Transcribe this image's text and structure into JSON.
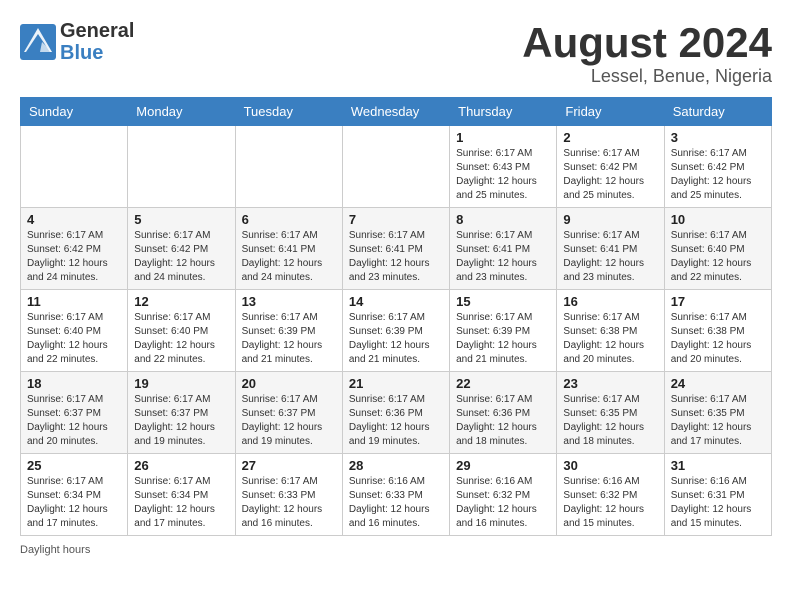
{
  "header": {
    "logo_general": "General",
    "logo_blue": "Blue",
    "main_title": "August 2024",
    "subtitle": "Lessel, Benue, Nigeria"
  },
  "footer": {
    "note": "Daylight hours"
  },
  "days_of_week": [
    "Sunday",
    "Monday",
    "Tuesday",
    "Wednesday",
    "Thursday",
    "Friday",
    "Saturday"
  ],
  "weeks": [
    [
      {
        "day": "",
        "sunrise": "",
        "sunset": "",
        "daylight": ""
      },
      {
        "day": "",
        "sunrise": "",
        "sunset": "",
        "daylight": ""
      },
      {
        "day": "",
        "sunrise": "",
        "sunset": "",
        "daylight": ""
      },
      {
        "day": "",
        "sunrise": "",
        "sunset": "",
        "daylight": ""
      },
      {
        "day": "1",
        "sunrise": "Sunrise: 6:17 AM",
        "sunset": "Sunset: 6:43 PM",
        "daylight": "Daylight: 12 hours and 25 minutes."
      },
      {
        "day": "2",
        "sunrise": "Sunrise: 6:17 AM",
        "sunset": "Sunset: 6:42 PM",
        "daylight": "Daylight: 12 hours and 25 minutes."
      },
      {
        "day": "3",
        "sunrise": "Sunrise: 6:17 AM",
        "sunset": "Sunset: 6:42 PM",
        "daylight": "Daylight: 12 hours and 25 minutes."
      }
    ],
    [
      {
        "day": "4",
        "sunrise": "Sunrise: 6:17 AM",
        "sunset": "Sunset: 6:42 PM",
        "daylight": "Daylight: 12 hours and 24 minutes."
      },
      {
        "day": "5",
        "sunrise": "Sunrise: 6:17 AM",
        "sunset": "Sunset: 6:42 PM",
        "daylight": "Daylight: 12 hours and 24 minutes."
      },
      {
        "day": "6",
        "sunrise": "Sunrise: 6:17 AM",
        "sunset": "Sunset: 6:41 PM",
        "daylight": "Daylight: 12 hours and 24 minutes."
      },
      {
        "day": "7",
        "sunrise": "Sunrise: 6:17 AM",
        "sunset": "Sunset: 6:41 PM",
        "daylight": "Daylight: 12 hours and 23 minutes."
      },
      {
        "day": "8",
        "sunrise": "Sunrise: 6:17 AM",
        "sunset": "Sunset: 6:41 PM",
        "daylight": "Daylight: 12 hours and 23 minutes."
      },
      {
        "day": "9",
        "sunrise": "Sunrise: 6:17 AM",
        "sunset": "Sunset: 6:41 PM",
        "daylight": "Daylight: 12 hours and 23 minutes."
      },
      {
        "day": "10",
        "sunrise": "Sunrise: 6:17 AM",
        "sunset": "Sunset: 6:40 PM",
        "daylight": "Daylight: 12 hours and 22 minutes."
      }
    ],
    [
      {
        "day": "11",
        "sunrise": "Sunrise: 6:17 AM",
        "sunset": "Sunset: 6:40 PM",
        "daylight": "Daylight: 12 hours and 22 minutes."
      },
      {
        "day": "12",
        "sunrise": "Sunrise: 6:17 AM",
        "sunset": "Sunset: 6:40 PM",
        "daylight": "Daylight: 12 hours and 22 minutes."
      },
      {
        "day": "13",
        "sunrise": "Sunrise: 6:17 AM",
        "sunset": "Sunset: 6:39 PM",
        "daylight": "Daylight: 12 hours and 21 minutes."
      },
      {
        "day": "14",
        "sunrise": "Sunrise: 6:17 AM",
        "sunset": "Sunset: 6:39 PM",
        "daylight": "Daylight: 12 hours and 21 minutes."
      },
      {
        "day": "15",
        "sunrise": "Sunrise: 6:17 AM",
        "sunset": "Sunset: 6:39 PM",
        "daylight": "Daylight: 12 hours and 21 minutes."
      },
      {
        "day": "16",
        "sunrise": "Sunrise: 6:17 AM",
        "sunset": "Sunset: 6:38 PM",
        "daylight": "Daylight: 12 hours and 20 minutes."
      },
      {
        "day": "17",
        "sunrise": "Sunrise: 6:17 AM",
        "sunset": "Sunset: 6:38 PM",
        "daylight": "Daylight: 12 hours and 20 minutes."
      }
    ],
    [
      {
        "day": "18",
        "sunrise": "Sunrise: 6:17 AM",
        "sunset": "Sunset: 6:37 PM",
        "daylight": "Daylight: 12 hours and 20 minutes."
      },
      {
        "day": "19",
        "sunrise": "Sunrise: 6:17 AM",
        "sunset": "Sunset: 6:37 PM",
        "daylight": "Daylight: 12 hours and 19 minutes."
      },
      {
        "day": "20",
        "sunrise": "Sunrise: 6:17 AM",
        "sunset": "Sunset: 6:37 PM",
        "daylight": "Daylight: 12 hours and 19 minutes."
      },
      {
        "day": "21",
        "sunrise": "Sunrise: 6:17 AM",
        "sunset": "Sunset: 6:36 PM",
        "daylight": "Daylight: 12 hours and 19 minutes."
      },
      {
        "day": "22",
        "sunrise": "Sunrise: 6:17 AM",
        "sunset": "Sunset: 6:36 PM",
        "daylight": "Daylight: 12 hours and 18 minutes."
      },
      {
        "day": "23",
        "sunrise": "Sunrise: 6:17 AM",
        "sunset": "Sunset: 6:35 PM",
        "daylight": "Daylight: 12 hours and 18 minutes."
      },
      {
        "day": "24",
        "sunrise": "Sunrise: 6:17 AM",
        "sunset": "Sunset: 6:35 PM",
        "daylight": "Daylight: 12 hours and 17 minutes."
      }
    ],
    [
      {
        "day": "25",
        "sunrise": "Sunrise: 6:17 AM",
        "sunset": "Sunset: 6:34 PM",
        "daylight": "Daylight: 12 hours and 17 minutes."
      },
      {
        "day": "26",
        "sunrise": "Sunrise: 6:17 AM",
        "sunset": "Sunset: 6:34 PM",
        "daylight": "Daylight: 12 hours and 17 minutes."
      },
      {
        "day": "27",
        "sunrise": "Sunrise: 6:17 AM",
        "sunset": "Sunset: 6:33 PM",
        "daylight": "Daylight: 12 hours and 16 minutes."
      },
      {
        "day": "28",
        "sunrise": "Sunrise: 6:16 AM",
        "sunset": "Sunset: 6:33 PM",
        "daylight": "Daylight: 12 hours and 16 minutes."
      },
      {
        "day": "29",
        "sunrise": "Sunrise: 6:16 AM",
        "sunset": "Sunset: 6:32 PM",
        "daylight": "Daylight: 12 hours and 16 minutes."
      },
      {
        "day": "30",
        "sunrise": "Sunrise: 6:16 AM",
        "sunset": "Sunset: 6:32 PM",
        "daylight": "Daylight: 12 hours and 15 minutes."
      },
      {
        "day": "31",
        "sunrise": "Sunrise: 6:16 AM",
        "sunset": "Sunset: 6:31 PM",
        "daylight": "Daylight: 12 hours and 15 minutes."
      }
    ]
  ]
}
